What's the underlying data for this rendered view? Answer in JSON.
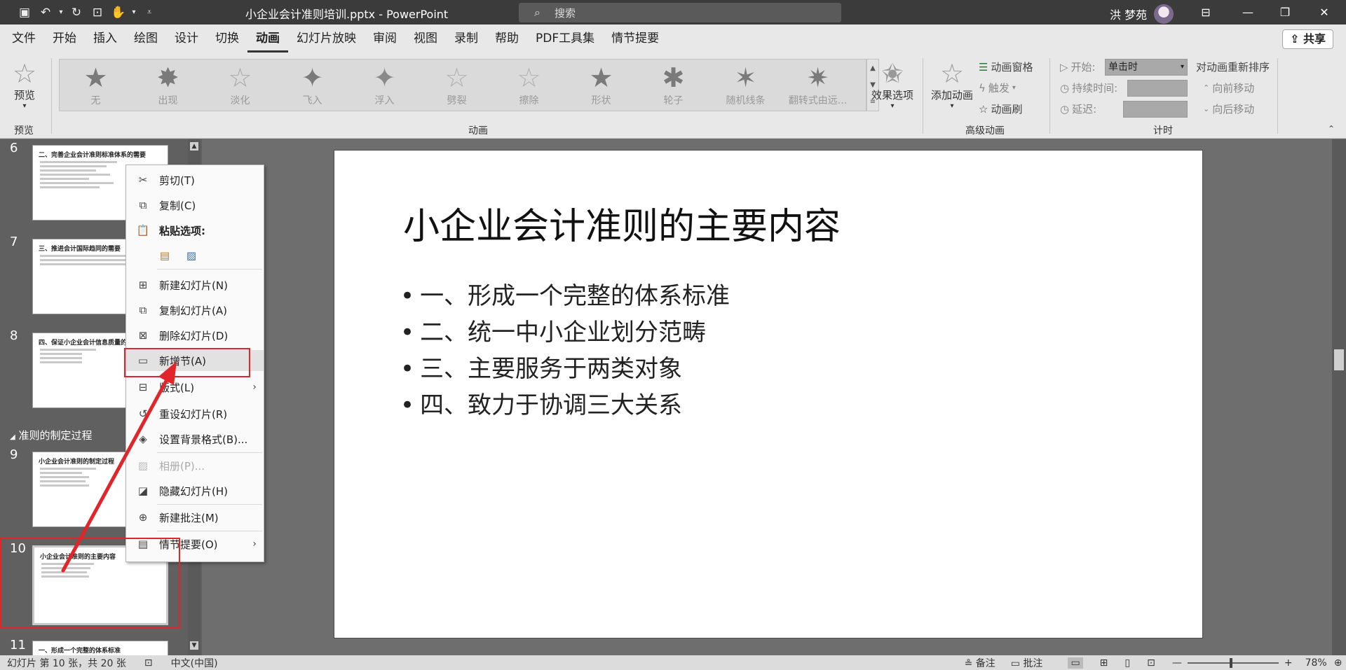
{
  "window": {
    "title": "小企业会计准则培训.pptx - PowerPoint",
    "search_placeholder": "搜索",
    "user_name": "洪 梦苑"
  },
  "menu": {
    "items": [
      "文件",
      "开始",
      "插入",
      "绘图",
      "设计",
      "切换",
      "动画",
      "幻灯片放映",
      "审阅",
      "视图",
      "录制",
      "帮助",
      "PDF工具集",
      "情节提要"
    ],
    "active": "动画",
    "share_label": "共享"
  },
  "ribbon": {
    "preview_label": "预览",
    "preview_group": "预览",
    "animations": [
      "无",
      "出现",
      "淡化",
      "飞入",
      "浮入",
      "劈裂",
      "擦除",
      "形状",
      "轮子",
      "随机线条",
      "翻转式由远..."
    ],
    "animation_group": "动画",
    "effect_options": "效果选项",
    "add_animation": "添加动画",
    "animation_pane": "动画窗格",
    "trigger": "触发",
    "animation_painter": "动画刷",
    "advanced_group": "高级动画",
    "start_label": "开始:",
    "start_value": "单击时",
    "duration_label": "持续时间:",
    "delay_label": "延迟:",
    "timing_group": "计时",
    "reorder_label": "对动画重新排序",
    "move_earlier": "向前移动",
    "move_later": "向后移动"
  },
  "thumbnails": {
    "slides": [
      {
        "num": "6",
        "title": "二、完善企业会计准则标准体系的需要"
      },
      {
        "num": "7",
        "title": "三、推进会计国际趋同的需要"
      },
      {
        "num": "8",
        "title": "四、保证小企业会计信息质量的需要"
      },
      {
        "num": "9",
        "title": "小企业会计准则的制定过程"
      },
      {
        "num": "10",
        "title": "小企业会计准则的主要内容"
      },
      {
        "num": "11",
        "title": "一、形成一个完整的体系标准"
      }
    ],
    "section_name": "准则的制定过程"
  },
  "slide": {
    "title": "小企业会计准则的主要内容",
    "bullets": [
      "一、形成一个完整的体系标准",
      "二、统一中小企业划分范畴",
      "三、主要服务于两类对象",
      "四、致力于协调三大关系"
    ]
  },
  "context_menu": {
    "cut": "剪切(T)",
    "copy": "复制(C)",
    "paste_options": "粘贴选项:",
    "new_slide": "新建幻灯片(N)",
    "duplicate_slide": "复制幻灯片(A)",
    "delete_slide": "删除幻灯片(D)",
    "add_section": "新增节(A)",
    "layout": "版式(L)",
    "reset_slide": "重设幻灯片(R)",
    "format_background": "设置背景格式(B)...",
    "photo_album": "相册(P)...",
    "hide_slide": "隐藏幻灯片(H)",
    "new_comment": "新建批注(M)",
    "storyboard": "情节提要(O)"
  },
  "status": {
    "slide_info": "幻灯片 第 10 张，共 20 张",
    "language": "中文(中国)",
    "notes": "备注",
    "comments": "批注",
    "zoom": "78%"
  },
  "colors": {
    "accent_red": "#e0252b",
    "titlebar": "#3b3b3b",
    "ribbon": "#e8e8e8"
  }
}
